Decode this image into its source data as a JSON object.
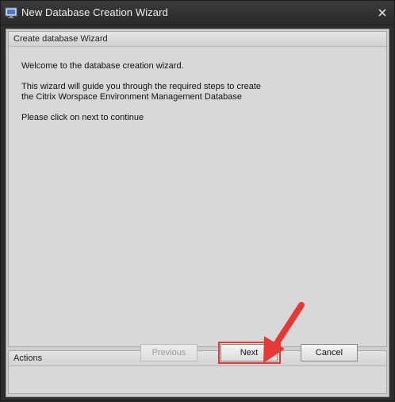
{
  "window": {
    "title": "New Database Creation Wizard"
  },
  "wizard": {
    "header": "Create database Wizard",
    "welcome": "Welcome to the database creation wizard.",
    "description": "This wizard will guide you through the required steps to create the Citrix Worspace Environment Management Database",
    "instruction": "Please click on next to continue"
  },
  "actions": {
    "header": "Actions",
    "previous_label": "Previous",
    "next_label": "Next",
    "cancel_label": "Cancel"
  },
  "colors": {
    "highlight": "#e53935",
    "titlebar": "#2d2d2d"
  },
  "icons": {
    "title": "monitor-icon",
    "close": "close-icon",
    "annotation": "red-arrow-icon"
  }
}
